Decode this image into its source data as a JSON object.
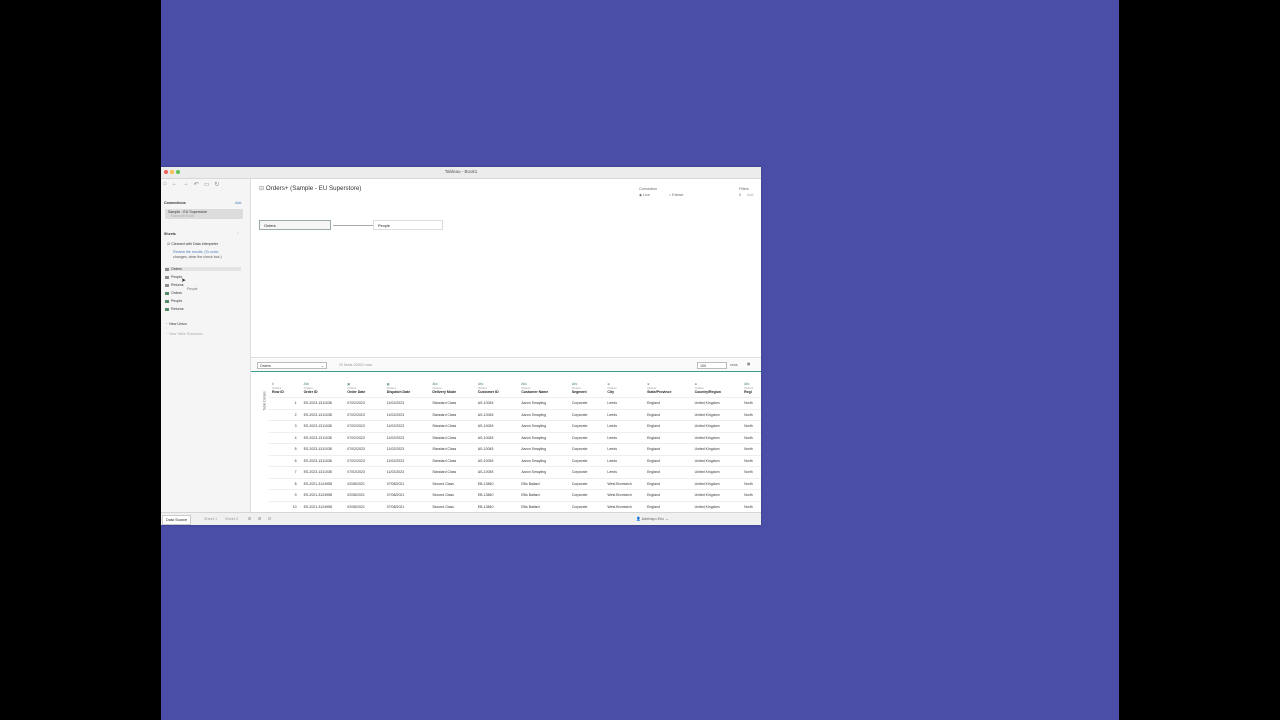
{
  "window": {
    "title": "Tableau - Book1"
  },
  "left_panel": {
    "connections_title": "Connections",
    "connections_add": "Add",
    "connection_name": "Sample - EU Superstore",
    "connection_type": "Microsoft Excel",
    "sheets_title": "Sheets",
    "cleaned_label": "Cleaned with Data Interpreter",
    "review_text": "Review the results. (To undo",
    "review_text2": "changes, clear the check box.)",
    "sheets": [
      "Orders",
      "People",
      "Returns",
      "Orders",
      "People",
      "Returns"
    ],
    "drag_ghost": "People",
    "new_union": "New Union",
    "new_table_extension": "New Table Extension"
  },
  "main": {
    "datasource_title": "Orders+ (Sample - EU Superstore)",
    "tables": [
      "Orders",
      "People"
    ],
    "connection_label": "Connection",
    "live_label": "Live",
    "extract_label": "Extract",
    "filters_label": "Filters",
    "filters_count": "0",
    "filters_add": "Add",
    "grid_select": "Orders",
    "grid_info": "20 fields 10000 rows",
    "rows_value": "100",
    "rows_label": "rows",
    "side_label": "Table Details"
  },
  "grid": {
    "source": "Orders",
    "columns": [
      {
        "name": "Row ID",
        "icon": "#"
      },
      {
        "name": "Order ID",
        "icon": "Abc"
      },
      {
        "name": "Order Date",
        "icon": "date"
      },
      {
        "name": "Dispatch Date",
        "icon": "date"
      },
      {
        "name": "Delivery Mode",
        "icon": "Abc"
      },
      {
        "name": "Customer ID",
        "icon": "Abc"
      },
      {
        "name": "Customer Name",
        "icon": "Abc"
      },
      {
        "name": "Segment",
        "icon": "Abc"
      },
      {
        "name": "City",
        "icon": "geo"
      },
      {
        "name": "State/Province",
        "icon": "geo"
      },
      {
        "name": "Country/Region",
        "icon": "geo"
      },
      {
        "name": "Regi",
        "icon": "Abc"
      }
    ],
    "rows": [
      [
        "1",
        "ES-2023-1311038",
        "07/02/2023",
        "11/02/2023",
        "Standard Class",
        "AS-10045",
        "Aaron Smayling",
        "Corporate",
        "Leeds",
        "England",
        "United Kingdom",
        "North"
      ],
      [
        "2",
        "ES-2023-1311038",
        "07/02/2023",
        "11/02/2023",
        "Standard Class",
        "AS-10045",
        "Aaron Smayling",
        "Corporate",
        "Leeds",
        "England",
        "United Kingdom",
        "North"
      ],
      [
        "3",
        "ES-2023-1311038",
        "07/02/2023",
        "11/02/2023",
        "Standard Class",
        "AS-10045",
        "Aaron Smayling",
        "Corporate",
        "Leeds",
        "England",
        "United Kingdom",
        "North"
      ],
      [
        "4",
        "ES-2023-1311038",
        "07/02/2023",
        "11/02/2023",
        "Standard Class",
        "AS-10045",
        "Aaron Smayling",
        "Corporate",
        "Leeds",
        "England",
        "United Kingdom",
        "North"
      ],
      [
        "5",
        "ES-2023-1311038",
        "07/02/2023",
        "11/02/2023",
        "Standard Class",
        "AS-10045",
        "Aaron Smayling",
        "Corporate",
        "Leeds",
        "England",
        "United Kingdom",
        "North"
      ],
      [
        "6",
        "ES-2023-1311038",
        "07/02/2023",
        "11/02/2023",
        "Standard Class",
        "AS-10045",
        "Aaron Smayling",
        "Corporate",
        "Leeds",
        "England",
        "United Kingdom",
        "North"
      ],
      [
        "7",
        "ES-2023-1311038",
        "07/02/2023",
        "11/02/2023",
        "Standard Class",
        "AS-10045",
        "Aaron Smayling",
        "Corporate",
        "Leeds",
        "England",
        "United Kingdom",
        "North"
      ],
      [
        "8",
        "ES-2021-3124958",
        "02/08/2021",
        "07/08/2021",
        "Second Class",
        "EB-13840",
        "Ellis Ballard",
        "Corporate",
        "West Bromwich",
        "England",
        "United Kingdom",
        "North"
      ],
      [
        "9",
        "ES-2021-3124958",
        "02/08/2021",
        "07/08/2021",
        "Second Class",
        "EB-13840",
        "Ellis Ballard",
        "Corporate",
        "West Bromwich",
        "England",
        "United Kingdom",
        "North"
      ],
      [
        "10",
        "ES-2021-3124958",
        "02/08/2021",
        "07/08/2021",
        "Second Class",
        "EB-13840",
        "Ellis Ballard",
        "Corporate",
        "West Bromwich",
        "England",
        "United Kingdom",
        "North"
      ]
    ]
  },
  "bottom_tabs": [
    "Data Source",
    "Sheet 1",
    "Sheet 2"
  ],
  "status": {
    "user": "Adebayo Eric"
  },
  "colors": {
    "stage": "#4a4ea6",
    "accent": "#3a9c8f",
    "sheet_icon": "#4b8a5f"
  }
}
